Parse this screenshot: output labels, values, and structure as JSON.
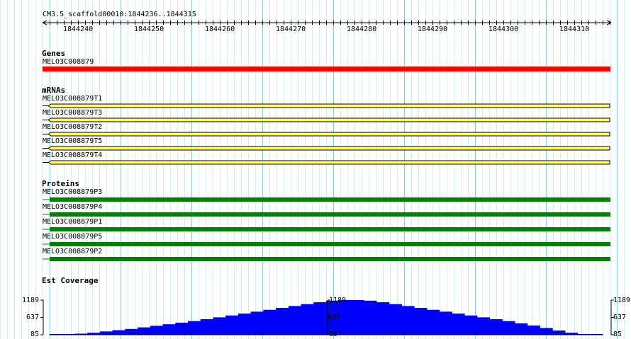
{
  "ruler": {
    "title": "CM3.5_scaffold00010:1844236..1844315",
    "start": 1844236,
    "end": 1844315,
    "ticks": [
      "1844240",
      "1844250",
      "1844260",
      "1844270",
      "1844280",
      "1844290",
      "1844300",
      "1844310"
    ]
  },
  "tracks": {
    "genes": {
      "heading": "Genes",
      "color": "#ff0000",
      "items": [
        {
          "label": "MELO3C008879"
        }
      ]
    },
    "mrnas": {
      "heading": "mRNAs",
      "color": "#ffff66",
      "items": [
        {
          "label": "MELO3C008879T1"
        },
        {
          "label": "MELO3C008879T3"
        },
        {
          "label": "MELO3C008879T2"
        },
        {
          "label": "MELO3C008879T5"
        },
        {
          "label": "MELO3C008879T4"
        }
      ]
    },
    "proteins": {
      "heading": "Proteins",
      "color": "#008000",
      "items": [
        {
          "label": "MELO3C008879P3"
        },
        {
          "label": "MELO3C008879P4"
        },
        {
          "label": "MELO3C008879P1"
        },
        {
          "label": "MELO3C008879P5"
        },
        {
          "label": "MELO3C008879P2"
        }
      ]
    }
  },
  "coverage": {
    "heading": "Est Coverage",
    "color": "#0000ff",
    "axis": {
      "max": "1189",
      "mid": "637",
      "min": "85"
    },
    "values": [
      85,
      85,
      120,
      150,
      190,
      230,
      270,
      320,
      370,
      420,
      470,
      520,
      580,
      640,
      700,
      760,
      820,
      880,
      940,
      1000,
      1060,
      1120,
      1170,
      1189,
      1189,
      1170,
      1120,
      1060,
      1000,
      940,
      880,
      820,
      760,
      700,
      640,
      580,
      520,
      450,
      380,
      300,
      220,
      150,
      100,
      85
    ]
  }
}
